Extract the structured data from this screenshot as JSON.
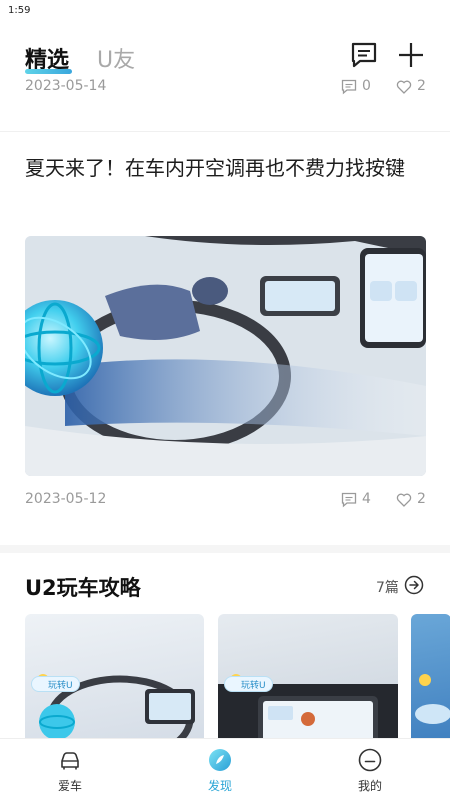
{
  "status_bar": {
    "time": "1:59"
  },
  "header": {
    "tabs": [
      {
        "label": "精选",
        "active": true
      },
      {
        "label": "U友",
        "active": false
      }
    ],
    "accent_color": "#3aa7dd"
  },
  "previous_article": {
    "date": "2023-05-14",
    "comments": "0",
    "likes": "2"
  },
  "article": {
    "title": "夏天来了！在车内开空调再也不费力找按键",
    "date": "2023-05-12",
    "comments": "4",
    "likes": "2"
  },
  "section": {
    "title": "U2玩车攻略",
    "count": "7篇",
    "cards": [
      {
        "tag": "玩转U"
      },
      {
        "tag": "玩转U"
      },
      {
        "tag": ""
      }
    ]
  },
  "bottom_nav": {
    "items": [
      {
        "label": "爱车",
        "icon": "car-icon",
        "active": false
      },
      {
        "label": "发现",
        "icon": "discover-icon",
        "active": true
      },
      {
        "label": "我的",
        "icon": "profile-icon",
        "active": false
      }
    ]
  }
}
